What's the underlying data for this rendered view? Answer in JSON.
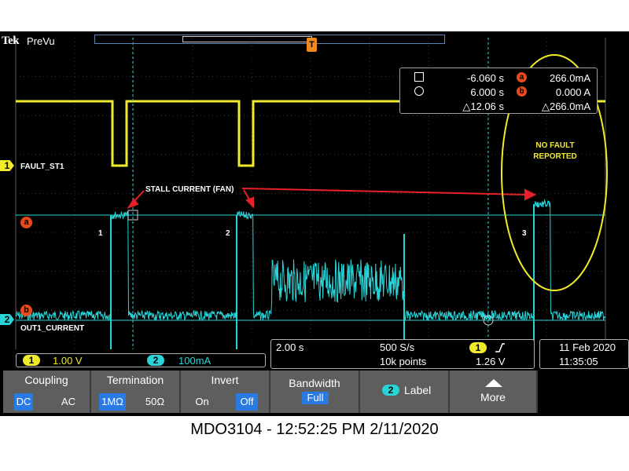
{
  "instrument": {
    "brand": "Tek",
    "mode": "PreVu",
    "trigger_marker": "T"
  },
  "cursor_readout": {
    "rows": [
      {
        "symbol": "square",
        "time": "-6.060 s",
        "badge": "a",
        "value": "266.0mA"
      },
      {
        "symbol": "circle",
        "time": "6.000 s",
        "badge": "b",
        "value": "0.000 A"
      },
      {
        "symbol": "delta",
        "time": "△12.06 s",
        "badge": "",
        "value": "△266.0mA"
      }
    ]
  },
  "channels": [
    {
      "number": "1",
      "label": "FAULT_ST1",
      "color": "#f0ea2a",
      "scale": "1.00 V"
    },
    {
      "number": "2",
      "label": "OUT1_CURRENT",
      "color": "#29d4d8",
      "scale": "100mA"
    }
  ],
  "ref_markers": [
    "a",
    "b"
  ],
  "annotations": {
    "stall": "STALL CURRENT (FAN)",
    "no_fault_line1": "NO FAULT",
    "no_fault_line2": "REPORTED",
    "events": [
      "1",
      "2",
      "3"
    ]
  },
  "horizontal": {
    "timebase": "2.00 s",
    "sample_rate": "500 S/s",
    "record_length": "10k points",
    "trigger_channel": "1",
    "trigger_slope_icon": "rising-edge-icon",
    "trigger_level": "1.26 V"
  },
  "datetime": {
    "date": "11 Feb  2020",
    "time": "11:35:05"
  },
  "menu": {
    "coupling": {
      "title": "Coupling",
      "options": [
        "DC",
        "AC"
      ],
      "selected": "DC"
    },
    "termination": {
      "title": "Termination",
      "options": [
        "1MΩ",
        "50Ω"
      ],
      "selected": "1MΩ"
    },
    "invert": {
      "title": "Invert",
      "options": [
        "On",
        "Off"
      ],
      "selected": "Off"
    },
    "bandwidth": {
      "title": "Bandwidth",
      "value": "Full"
    },
    "label": {
      "channel": "2",
      "title": "Label"
    },
    "more": {
      "title": "More",
      "icon": "up-arrow-icon"
    }
  },
  "caption": "MDO3104 - 12:52:25 PM   2/11/2020",
  "colors": {
    "ch1": "#f0ea2a",
    "ch2": "#29d4d8",
    "annotation_arrow": "#e8202a",
    "cursor_badge": "#e84a1c",
    "highlight_ellipse": "#f0ea2a",
    "menu_selected": "#2a7ae4"
  }
}
